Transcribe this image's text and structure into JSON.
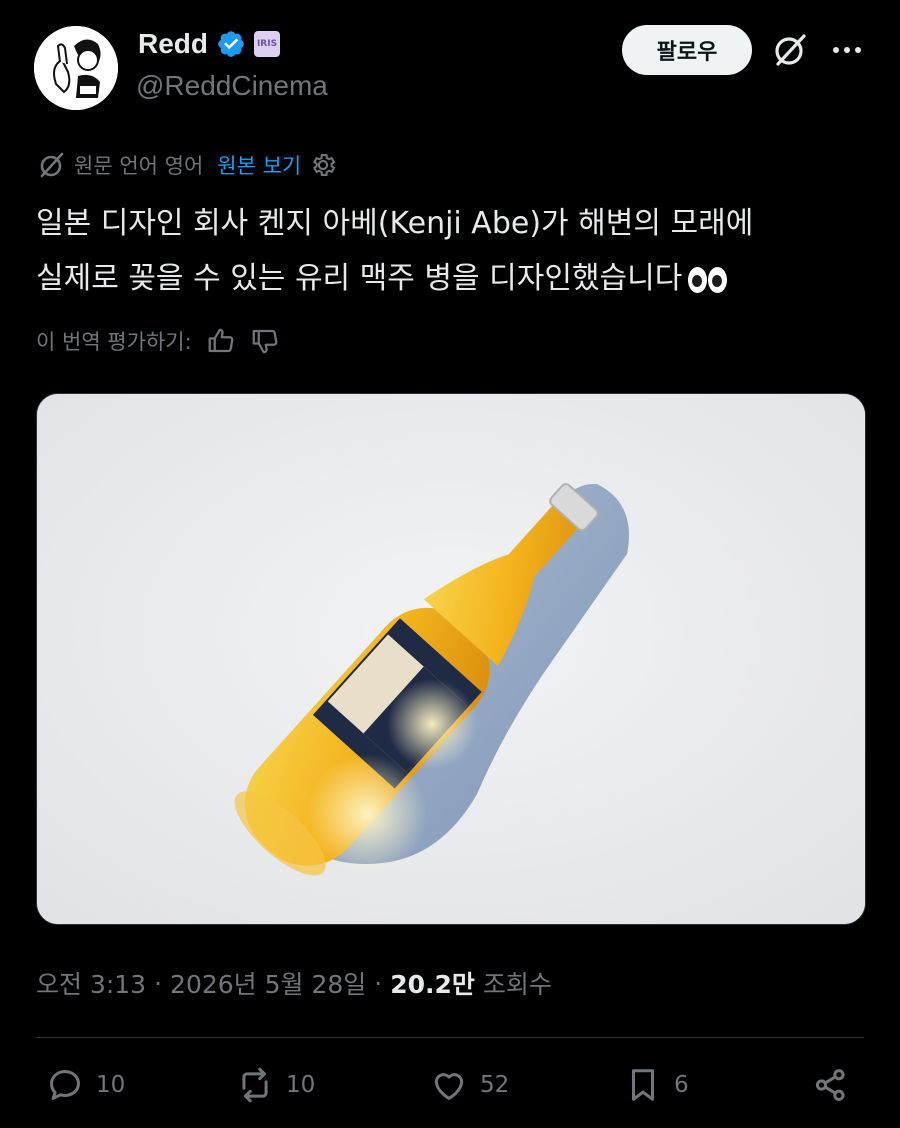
{
  "author": {
    "name": "Redd",
    "handle": "@ReddCinema",
    "badge_text": "IRIS"
  },
  "follow_label": "팔로우",
  "translation": {
    "source_note": "원문 언어 영어",
    "show_original": "원본 보기"
  },
  "tweet": {
    "line1": "일본 디자인 회사 켄지 아베(Kenji Abe)가 해변의 모래에",
    "line2": "실제로 꽂을 수 있는 유리 맥주 병을 디자인했습니다"
  },
  "rate_label": "이 번역 평가하기:",
  "meta": {
    "time": "오전 3:13",
    "date": "2026년 5월 28일",
    "sep": "·",
    "views_count": "20.2만",
    "views_label": "조회수"
  },
  "actions": {
    "replies": "10",
    "reposts": "10",
    "likes": "52",
    "bookmarks": "6"
  },
  "colors": {
    "accent": "#1d9bf0",
    "muted": "#71767b",
    "text": "#e7e9ea",
    "background": "#000000"
  }
}
